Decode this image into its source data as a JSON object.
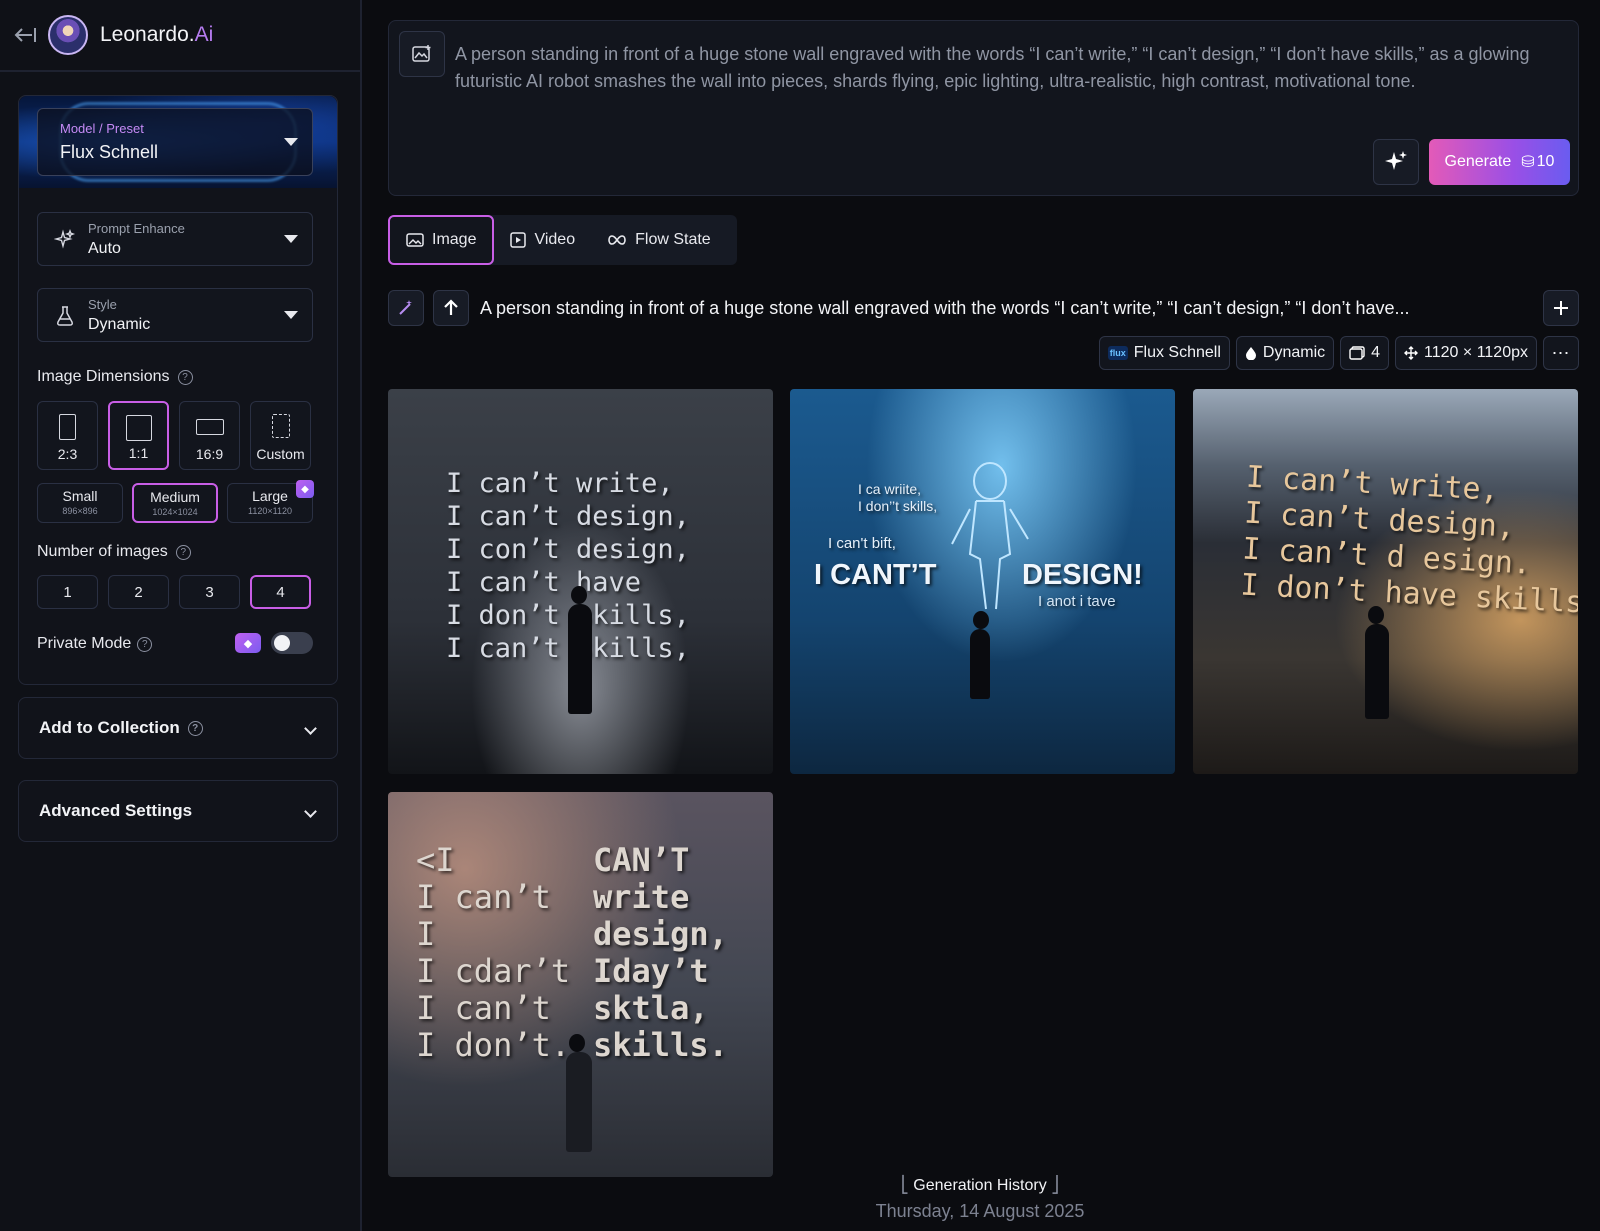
{
  "brand": {
    "name": "Leonardo.",
    "suffix": "Ai"
  },
  "sidebar": {
    "model": {
      "label": "Model / Preset",
      "value": "Flux Schnell"
    },
    "prompt_enhance": {
      "label": "Prompt Enhance",
      "value": "Auto"
    },
    "style": {
      "label": "Style",
      "value": "Dynamic"
    },
    "image_dimensions": {
      "title": "Image Dimensions",
      "ratios": [
        "2:3",
        "1:1",
        "16:9",
        "Custom"
      ],
      "selected_ratio": "1:1",
      "sizes": [
        {
          "name": "Small",
          "dims": "896×896"
        },
        {
          "name": "Medium",
          "dims": "1024×1024"
        },
        {
          "name": "Large",
          "dims": "1120×1120"
        }
      ],
      "selected_size": "Medium"
    },
    "number_of_images": {
      "title": "Number of images",
      "options": [
        "1",
        "2",
        "3",
        "4"
      ],
      "selected": "4"
    },
    "private_mode": {
      "label": "Private Mode",
      "enabled": false
    },
    "add_to_collection": "Add to Collection",
    "advanced_settings": "Advanced Settings",
    "help_glyph": "?"
  },
  "prompt": {
    "text": "A person standing in front of a huge stone wall engraved with the words “I can’t write,” “I can’t design,” “I don’t have skills,” as a glowing futuristic AI robot smashes the wall into pieces, shards flying, epic lighting, ultra-realistic, high contrast, motivational tone.",
    "generate_label": "Generate",
    "generate_cost": "10"
  },
  "modes": [
    {
      "label": "Image",
      "icon": "image-icon"
    },
    {
      "label": "Video",
      "icon": "video-icon"
    },
    {
      "label": "Flow State",
      "icon": "infinity-icon"
    }
  ],
  "generation": {
    "prompt": "A person standing in front of a huge stone wall engraved with the words “I can’t write,” “I can’t design,” “I don’t have...",
    "tags": {
      "model_badge": "flux",
      "model": "Flux Schnell",
      "style": "Dynamic",
      "count": "4",
      "size": "1120 × 1120px"
    },
    "images": [
      {
        "text": "I can’t write,\nI can’t design,\nI con’t design,\nI can’t have\nI don’t skills,\nI can’t skills,"
      },
      {
        "text_top": "I ca wriite,\nI don’’t skills,",
        "text_mid": "I can't bift,",
        "text_left": "I CANT’T",
        "text_right": "DESIGN!",
        "text_small": "I anot i tave"
      },
      {
        "text": "I can’t write,\nI can’t design,\nI can’t d esign.\nI don’t have skills."
      },
      {
        "text_left": "<I\nI can’t\nI\nI cdar’t\nI can’t\nI don’t.",
        "text_right": "CAN’T\nwrite\ndesign,\nIday’t\nsktla,\nskills."
      }
    ]
  },
  "history": {
    "title": "Generation History",
    "date": "Thursday, 14 August 2025"
  },
  "colors": {
    "accent": "#c85ee6",
    "generate_start": "#e35ab8",
    "generate_end": "#6a5cf0",
    "background": "#0b0c10"
  }
}
